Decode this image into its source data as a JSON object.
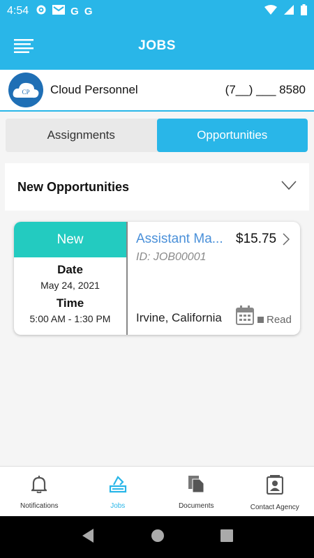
{
  "status_bar": {
    "time": "4:54",
    "icons": [
      "gear-icon",
      "mail-icon",
      "google-icon",
      "google-icon"
    ],
    "right_icons": [
      "wifi-icon",
      "signal-icon",
      "battery-icon"
    ]
  },
  "app_bar": {
    "title": "JOBS"
  },
  "agency": {
    "logo_text": "CP",
    "name": "Cloud Personnel",
    "phone": "(7__) ___ 8580"
  },
  "tabs": [
    {
      "label": "Assignments",
      "active": false
    },
    {
      "label": "Opportunities",
      "active": true
    }
  ],
  "section": {
    "title": "New Opportunities"
  },
  "job_card": {
    "badge": "New",
    "date_label": "Date",
    "date_value": "May 24, 2021",
    "time_label": "Time",
    "time_value": "5:00 AM - 1:30 PM",
    "title": "Assistant Ma...",
    "rate": "$15.75",
    "job_id": "ID: JOB00001",
    "location": "Irvine, California",
    "status": "Read"
  },
  "bottom_nav": [
    {
      "label": "Notifications",
      "icon": "bell-icon",
      "active": false
    },
    {
      "label": "Jobs",
      "icon": "jobs-icon",
      "active": true
    },
    {
      "label": "Documents",
      "icon": "documents-icon",
      "active": false
    },
    {
      "label": "Contact Agency",
      "icon": "contact-icon",
      "active": false
    }
  ],
  "colors": {
    "primary": "#29b6e8",
    "badge": "#23cbc0",
    "link": "#4a90d9"
  }
}
